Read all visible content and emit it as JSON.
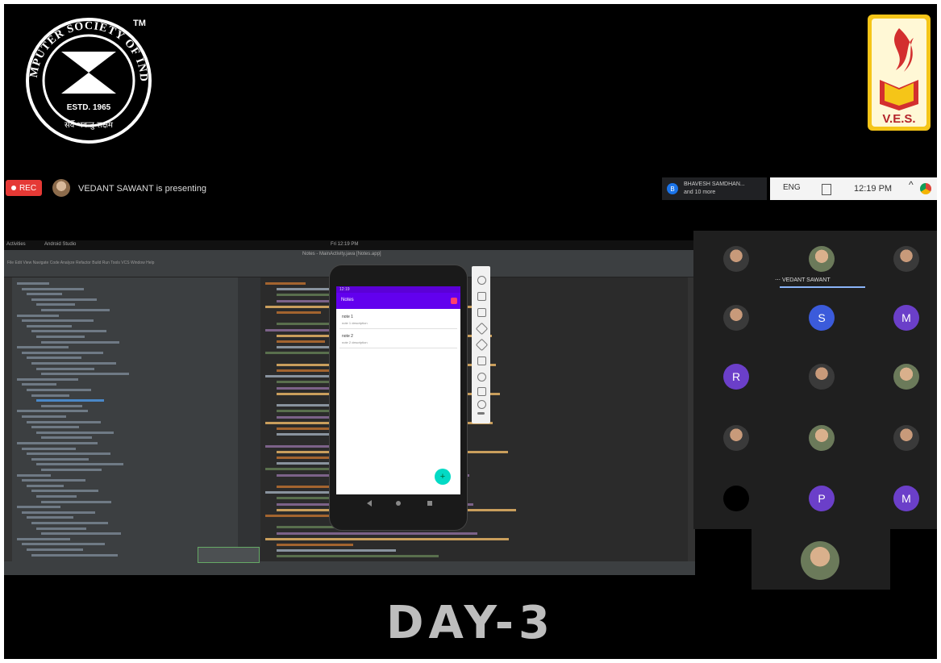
{
  "logos": {
    "csi_top_text": "COMPUTER SOCIETY OF INDIA",
    "csi_tm": "TM",
    "csi_estd": "ESTD. 1965",
    "csi_motto": "सर्वे भवन्तु सक्षम",
    "ves_text": "V.E.S."
  },
  "meeting": {
    "rec_label": "REC",
    "presenter_text": "VEDANT SAWANT is presenting",
    "participants_avatar_letter": "B",
    "participants_name": "BHAVESH SAMDHAN...",
    "participants_more": "and 10 more"
  },
  "tray": {
    "lang": "ENG",
    "time": "12:19 PM",
    "chevron": "^"
  },
  "ide": {
    "os_bar_left": "Activities",
    "os_bar_app": "Android Studio",
    "os_bar_center": "Fri 12:19 PM",
    "title": "Notes - MainActivity.java [Notes.app]",
    "menu": "File Edit View Navigate Code Analyze Refactor Build Run Tools VCS Window Help"
  },
  "emulator": {
    "status_time": "12:19",
    "app_title": "Notes",
    "notes": [
      {
        "title": "note 1",
        "desc": "note 1 description"
      },
      {
        "title": "note 2",
        "desc": "note 2 description"
      }
    ],
    "fab_icon": "+"
  },
  "participants": {
    "active_name": "VEDANT SAWANT",
    "active_prefix": "⋯",
    "tiles": [
      "",
      "",
      "",
      "",
      "S",
      "M",
      "R",
      "",
      "",
      "",
      "",
      "",
      "",
      "P",
      "M",
      ""
    ]
  },
  "footer": {
    "title": "DAY-3"
  }
}
